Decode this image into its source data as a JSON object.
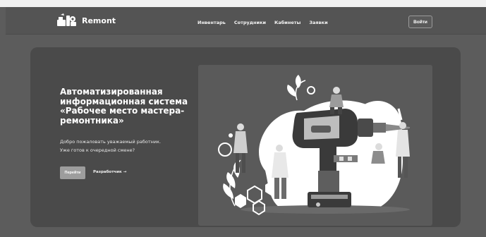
{
  "app": {
    "brand": "Remont",
    "logo_icon": "tools-icon"
  },
  "nav": {
    "items": [
      {
        "label": "Инвентарь"
      },
      {
        "label": "Сотрудники"
      },
      {
        "label": "Кабинеты"
      },
      {
        "label": "Заявки"
      }
    ],
    "login_label": "Войти"
  },
  "hero": {
    "title": "Автоматизированная информационная система «Рабочее место мастера-ремонтника»",
    "text_lines": [
      "Добро пожаловать уважаемый работник.",
      "Уже готов к очередной смене?"
    ],
    "primary_button": "Перейти",
    "secondary_link": "Разработчик →",
    "illustration_icon": "drill-workers-illustration"
  }
}
